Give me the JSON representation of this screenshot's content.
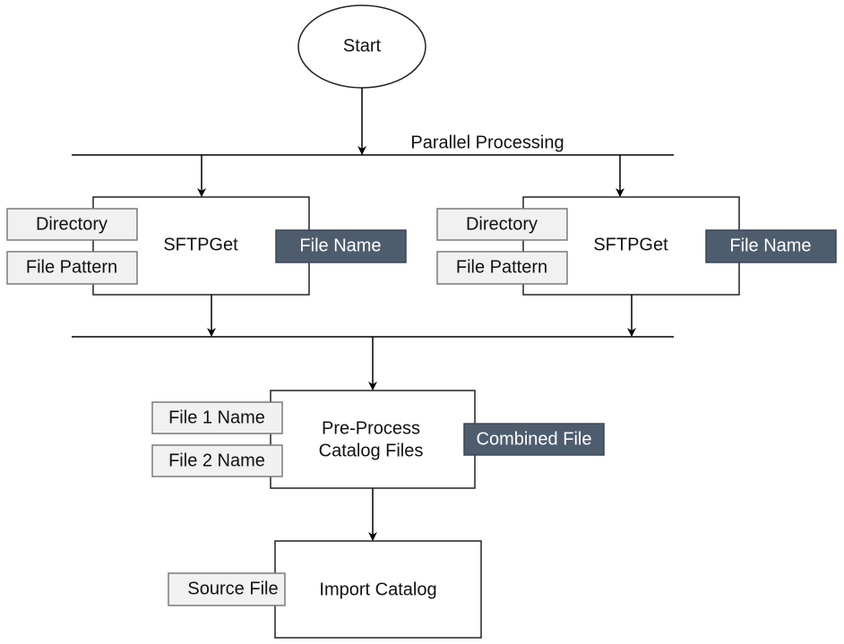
{
  "nodes": {
    "start": "Start",
    "parallel": "Parallel Processing",
    "sftp1": {
      "title": "SFTPGet",
      "inputs": [
        "Directory",
        "File Pattern"
      ],
      "output": "File Name"
    },
    "sftp2": {
      "title": "SFTPGet",
      "inputs": [
        "Directory",
        "File Pattern"
      ],
      "output": "File Name"
    },
    "preprocess": {
      "title_line1": "Pre-Process",
      "title_line2": "Catalog Files",
      "inputs": [
        "File 1 Name",
        "File 2 Name"
      ],
      "output": "Combined File"
    },
    "import": {
      "title": "Import Catalog",
      "inputs": [
        "Source File"
      ]
    }
  },
  "colors": {
    "input_fill": "#f1f1f1",
    "output_fill": "#4e5d6e"
  }
}
